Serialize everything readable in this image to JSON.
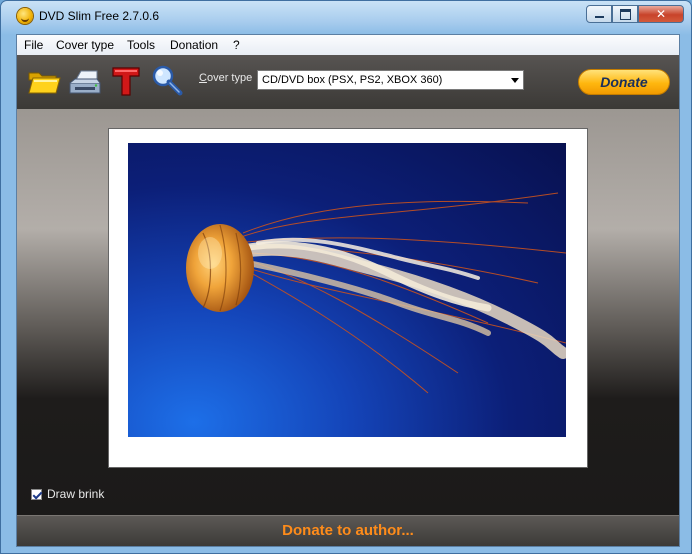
{
  "window": {
    "title": "DVD Slim Free 2.7.0.6",
    "close_glyph": "✕"
  },
  "menu": [
    {
      "label": "File"
    },
    {
      "label": "Cover type"
    },
    {
      "label": "Tools"
    },
    {
      "label": "Donation"
    },
    {
      "label": "?"
    }
  ],
  "toolbar": {
    "icons": [
      "open-folder-icon",
      "print-icon",
      "text-icon",
      "zoom-icon"
    ],
    "cover_type_label_first": "C",
    "cover_type_label_rest": "over type",
    "cover_type_value": "CD/DVD box (PSX, PS2, XBOX 360)",
    "donate_label": "Donate"
  },
  "preview": {
    "draw_brink_label": "Draw brink",
    "draw_brink_checked": true
  },
  "footer": {
    "donate_link": "Donate to author..."
  },
  "colors": {
    "toolbar_bg": "#4a4744",
    "accent_orange": "#ff8c1a",
    "donate_button": "#ffb70f"
  }
}
